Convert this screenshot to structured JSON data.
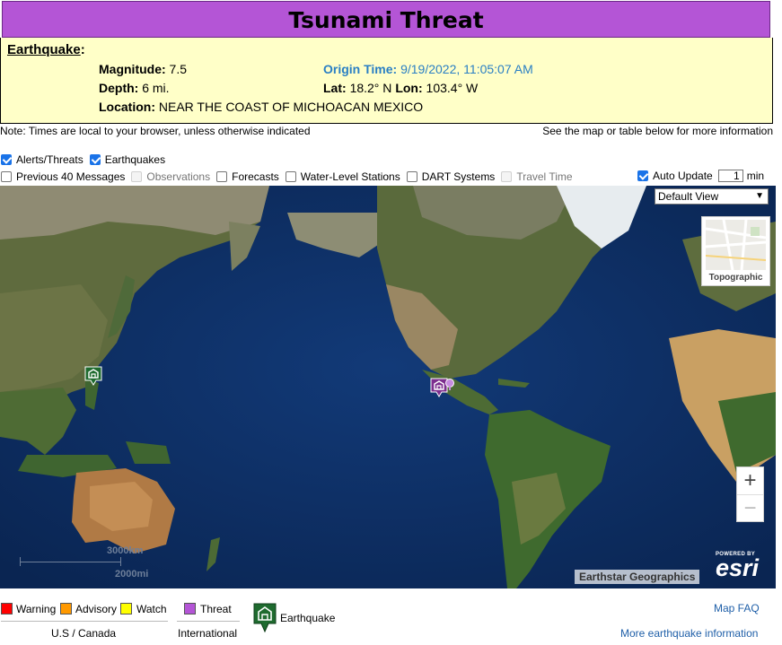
{
  "banner": {
    "title": "Tsunami Threat"
  },
  "earthquake": {
    "heading": "Earthquake",
    "magnitude_label": "Magnitude:",
    "magnitude": "7.5",
    "depth_label": "Depth:",
    "depth": "6 mi.",
    "location_label": "Location:",
    "location": "NEAR THE COAST OF MICHOACAN MEXICO",
    "origin_label": "Origin Time:",
    "origin_time": "9/19/2022, 11:05:07 AM",
    "lat_label": "Lat:",
    "lat": "18.2° N",
    "lon_label": "Lon:",
    "lon": "103.4° W"
  },
  "notes": {
    "left": "Note: Times are local to your browser, unless otherwise indicated",
    "right": "See the map or table below for more information"
  },
  "layers": {
    "row1": [
      {
        "label": "Alerts/Threats",
        "checked": true
      },
      {
        "label": "Earthquakes",
        "checked": true
      }
    ],
    "row2": [
      {
        "label": "Previous 40 Messages",
        "checked": false,
        "disabled": false
      },
      {
        "label": "Observations",
        "checked": false,
        "disabled": true
      },
      {
        "label": "Forecasts",
        "checked": false,
        "disabled": false
      },
      {
        "label": "Water-Level Stations",
        "checked": false,
        "disabled": false
      },
      {
        "label": "DART Systems",
        "checked": false,
        "disabled": false
      },
      {
        "label": "Travel Time",
        "checked": false,
        "disabled": true
      }
    ],
    "auto_update": {
      "label": "Auto Update",
      "value": "1",
      "unit": "min",
      "checked": true
    }
  },
  "map": {
    "view_select": "Default View",
    "basemap_label": "Topographic",
    "zoom_in": "+",
    "zoom_out": "−",
    "scale_km": "3000km",
    "scale_mi": "2000mi",
    "attribution": "Earthstar Geographics",
    "esri_powered": "POWERED BY",
    "esri_word": "esri",
    "colors": {
      "ocean": "#0d2e62",
      "threat": "#b455d6",
      "earthquake": "#1f6b2f"
    }
  },
  "legend": {
    "warning": "Warning",
    "advisory": "Advisory",
    "watch": "Watch",
    "threat": "Threat",
    "earthquake": "Earthquake",
    "us_canada": "U.S / Canada",
    "international": "International",
    "map_faq": "Map FAQ",
    "more_info": "More earthquake information",
    "colors": {
      "warning": "#ff0000",
      "advisory": "#ff9900",
      "watch": "#ffff00",
      "threat": "#b455d6"
    }
  }
}
